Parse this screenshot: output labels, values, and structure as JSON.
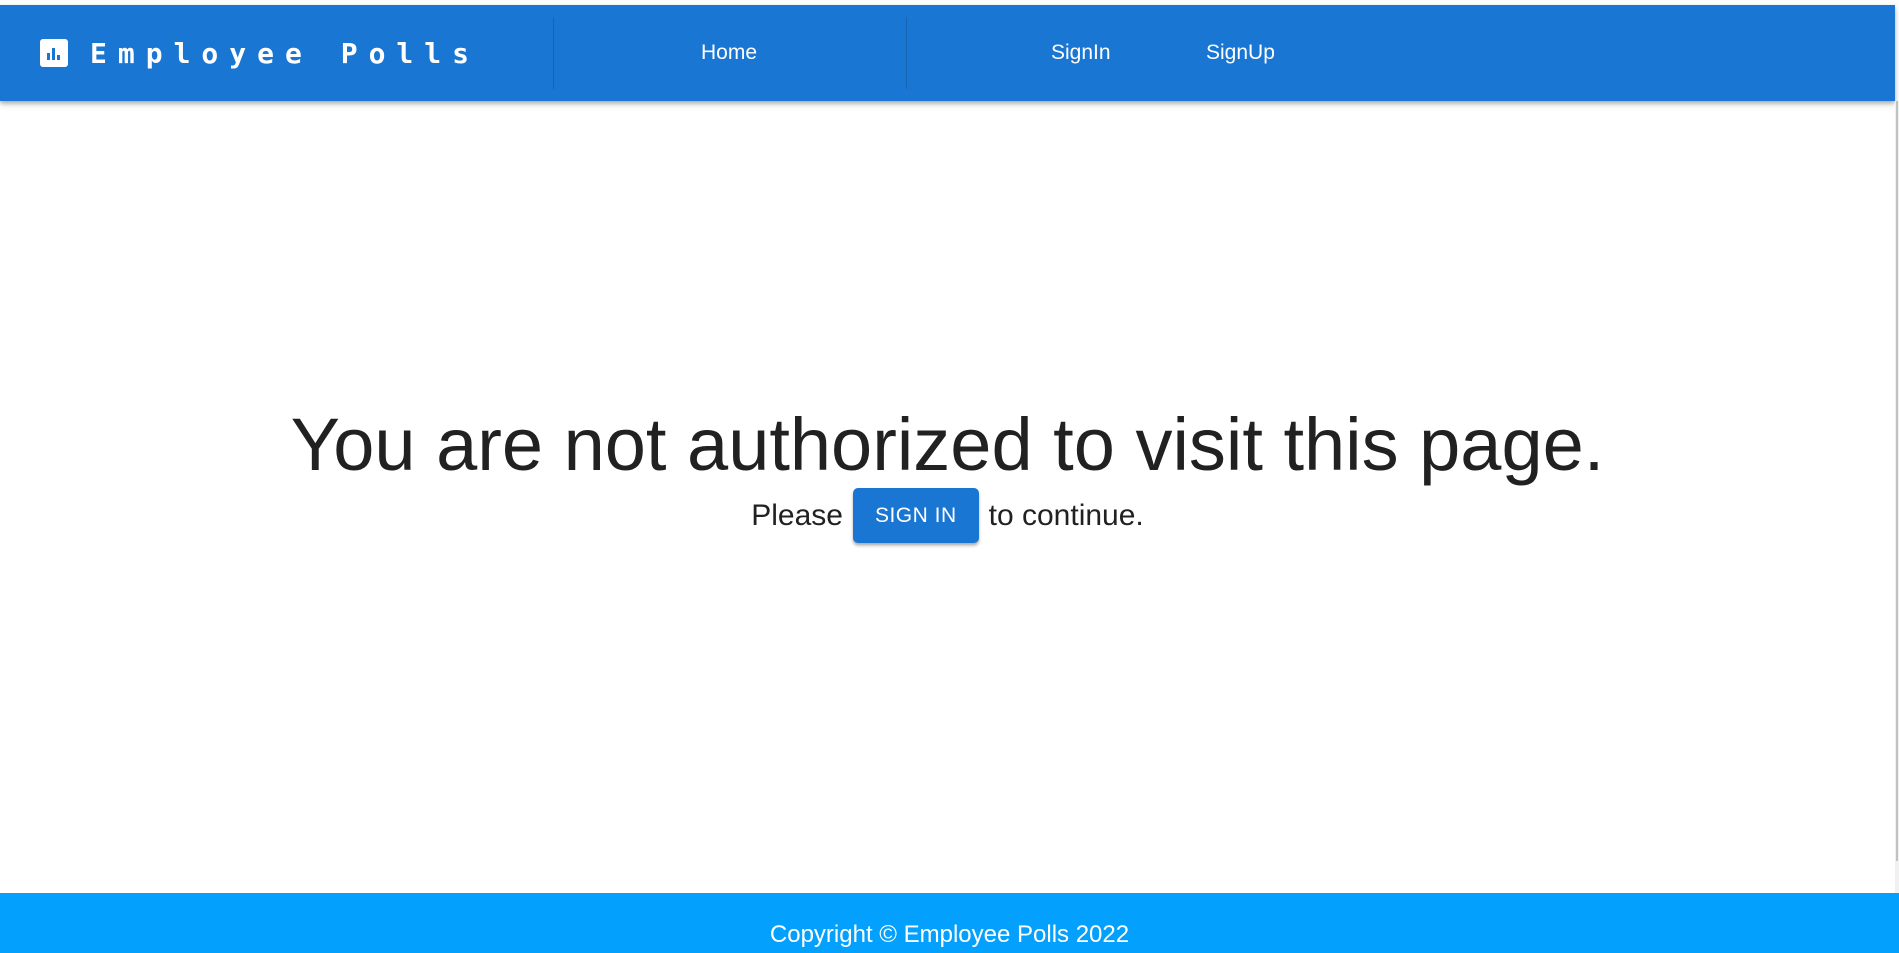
{
  "app": {
    "title": "Employee Polls",
    "icon": "bar-chart-icon",
    "brand_color": "#1976d2",
    "footer_color": "#03a0fe"
  },
  "nav": {
    "items": [
      {
        "label": "Home"
      },
      {
        "label": "SignIn"
      },
      {
        "label": "SignUp"
      }
    ]
  },
  "main": {
    "headline": "You are not authorized to visit this page.",
    "prefix": "Please",
    "signin_button": "SIGN IN",
    "suffix": "to continue."
  },
  "footer": {
    "text": "Copyright © Employee Polls 2022"
  }
}
